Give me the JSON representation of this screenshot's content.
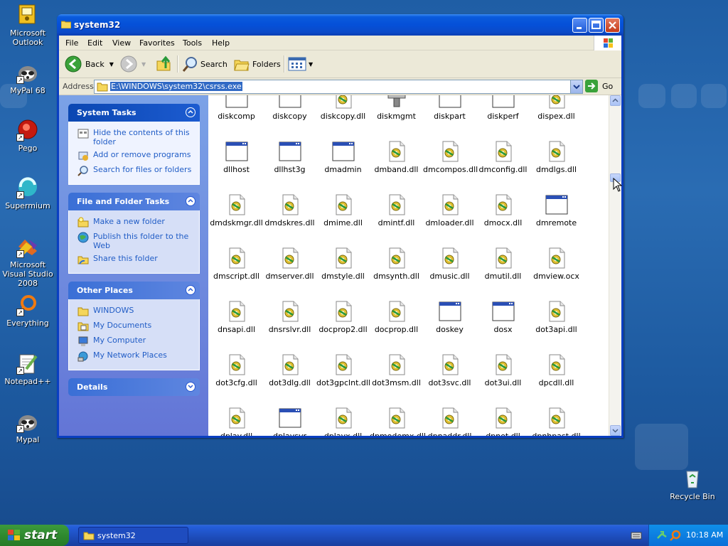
{
  "desktop": {
    "icons": [
      {
        "label": "Microsoft Outlook"
      },
      {
        "label": "MyPal 68"
      },
      {
        "label": "Pego"
      },
      {
        "label": "Supermium"
      },
      {
        "label": "Microsoft Visual Studio 2008"
      },
      {
        "label": "Everything"
      },
      {
        "label": "Notepad++"
      },
      {
        "label": "Mypal"
      },
      {
        "label": "Recycle Bin"
      }
    ]
  },
  "window": {
    "title": "system32",
    "menu": [
      "File",
      "Edit",
      "View",
      "Favorites",
      "Tools",
      "Help"
    ],
    "toolbar": {
      "back": "Back",
      "search": "Search",
      "folders": "Folders"
    },
    "address": {
      "label": "Address",
      "value": "E:\\WINDOWS\\system32\\csrss.exe",
      "go": "Go"
    },
    "taskpane": {
      "system_tasks": {
        "title": "System Tasks",
        "items": [
          "Hide the contents of this folder",
          "Add or remove programs",
          "Search for files or folders"
        ]
      },
      "file_folder_tasks": {
        "title": "File and Folder Tasks",
        "items": [
          "Make a new folder",
          "Publish this folder to the Web",
          "Share this folder"
        ]
      },
      "other_places": {
        "title": "Other Places",
        "items": [
          "WINDOWS",
          "My Documents",
          "My Computer",
          "My Network Places"
        ]
      },
      "details": {
        "title": "Details"
      }
    },
    "files": [
      {
        "name": "diskcomp",
        "type": "exe"
      },
      {
        "name": "diskcopy",
        "type": "exe"
      },
      {
        "name": "diskcopy.dll",
        "type": "dll"
      },
      {
        "name": "diskmgmt",
        "type": "msc"
      },
      {
        "name": "diskpart",
        "type": "exe"
      },
      {
        "name": "diskperf",
        "type": "exe"
      },
      {
        "name": "dispex.dll",
        "type": "dll"
      },
      {
        "name": "dllhost",
        "type": "exe"
      },
      {
        "name": "dllhst3g",
        "type": "exe"
      },
      {
        "name": "dmadmin",
        "type": "exe"
      },
      {
        "name": "dmband.dll",
        "type": "dll"
      },
      {
        "name": "dmcompos.dll",
        "type": "dll"
      },
      {
        "name": "dmconfig.dll",
        "type": "dll"
      },
      {
        "name": "dmdlgs.dll",
        "type": "dll"
      },
      {
        "name": "dmdskmgr.dll",
        "type": "dll"
      },
      {
        "name": "dmdskres.dll",
        "type": "dll"
      },
      {
        "name": "dmime.dll",
        "type": "dll"
      },
      {
        "name": "dmintf.dll",
        "type": "dll"
      },
      {
        "name": "dmloader.dll",
        "type": "dll"
      },
      {
        "name": "dmocx.dll",
        "type": "dll"
      },
      {
        "name": "dmremote",
        "type": "exe"
      },
      {
        "name": "dmscript.dll",
        "type": "dll"
      },
      {
        "name": "dmserver.dll",
        "type": "dll"
      },
      {
        "name": "dmstyle.dll",
        "type": "dll"
      },
      {
        "name": "dmsynth.dll",
        "type": "dll"
      },
      {
        "name": "dmusic.dll",
        "type": "dll"
      },
      {
        "name": "dmutil.dll",
        "type": "dll"
      },
      {
        "name": "dmview.ocx",
        "type": "dll"
      },
      {
        "name": "dnsapi.dll",
        "type": "dll"
      },
      {
        "name": "dnsrslvr.dll",
        "type": "dll"
      },
      {
        "name": "docprop2.dll",
        "type": "dll"
      },
      {
        "name": "docprop.dll",
        "type": "dll"
      },
      {
        "name": "doskey",
        "type": "exe"
      },
      {
        "name": "dosx",
        "type": "exe"
      },
      {
        "name": "dot3api.dll",
        "type": "dll"
      },
      {
        "name": "dot3cfg.dll",
        "type": "dll"
      },
      {
        "name": "dot3dlg.dll",
        "type": "dll"
      },
      {
        "name": "dot3gpclnt.dll",
        "type": "dll"
      },
      {
        "name": "dot3msm.dll",
        "type": "dll"
      },
      {
        "name": "dot3svc.dll",
        "type": "dll"
      },
      {
        "name": "dot3ui.dll",
        "type": "dll"
      },
      {
        "name": "dpcdll.dll",
        "type": "dll"
      },
      {
        "name": "dplay.dll",
        "type": "dll"
      },
      {
        "name": "dplaysvr",
        "type": "exe"
      },
      {
        "name": "dplayx.dll",
        "type": "dll"
      },
      {
        "name": "dpmodemx.dll",
        "type": "dll"
      },
      {
        "name": "dpnaddr.dll",
        "type": "dll"
      },
      {
        "name": "dpnet.dll",
        "type": "dll"
      },
      {
        "name": "dpnhpast.dll",
        "type": "dll"
      }
    ]
  },
  "taskbar": {
    "start": "start",
    "active_task": "system32",
    "clock": "10:18 AM"
  }
}
